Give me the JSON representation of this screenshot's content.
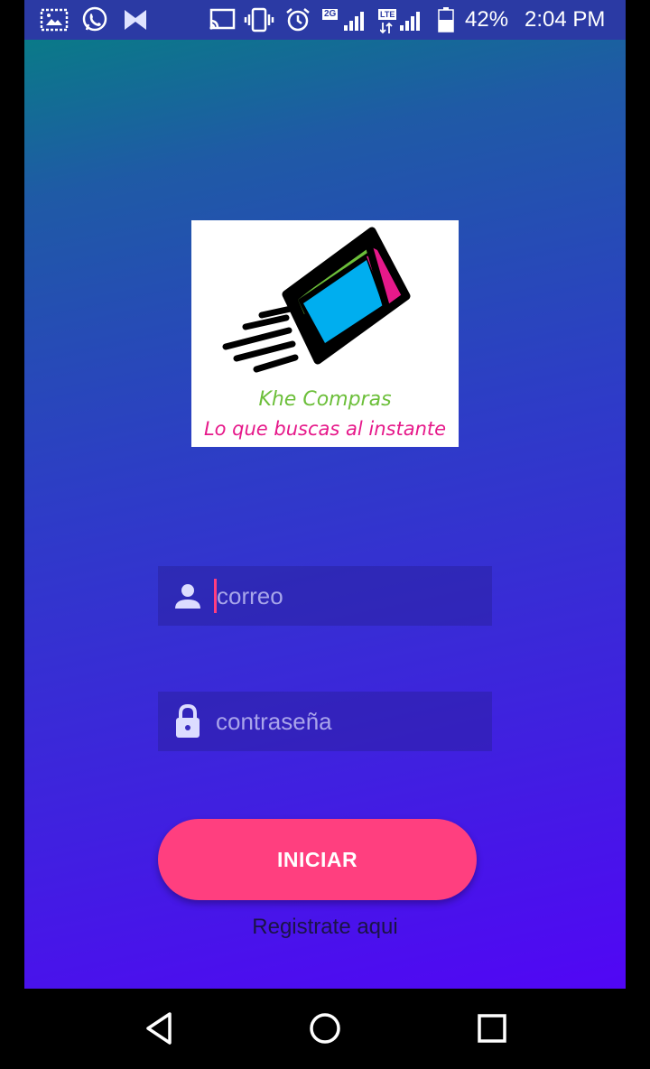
{
  "status_bar": {
    "icons": [
      "screenshot-icon",
      "whatsapp-icon",
      "bowtie-app-icon",
      "cast-icon",
      "vibrate-icon",
      "alarm-icon",
      "signal-2g-icon",
      "signal-lte-icon",
      "battery-icon"
    ],
    "badge_2g": "2G",
    "badge_lte": "LTE",
    "battery": "42%",
    "time": "2:04 PM"
  },
  "logo": {
    "brand": "Khe Compras",
    "tagline": "Lo que buscas al instante"
  },
  "form": {
    "email_placeholder": "correo",
    "password_placeholder": "contraseña",
    "login_label": "INICIAR",
    "register_label": "Registrate aqui"
  },
  "colors": {
    "accent": "#ff3f7f",
    "gradient_start": "#0a7a88",
    "gradient_end": "#5106f5",
    "logo_green": "#6cbf3a",
    "logo_magenta": "#e6198a",
    "cube_blue": "#00aeef"
  },
  "nav": {
    "icons": [
      "back-icon",
      "home-icon",
      "recents-icon"
    ]
  }
}
